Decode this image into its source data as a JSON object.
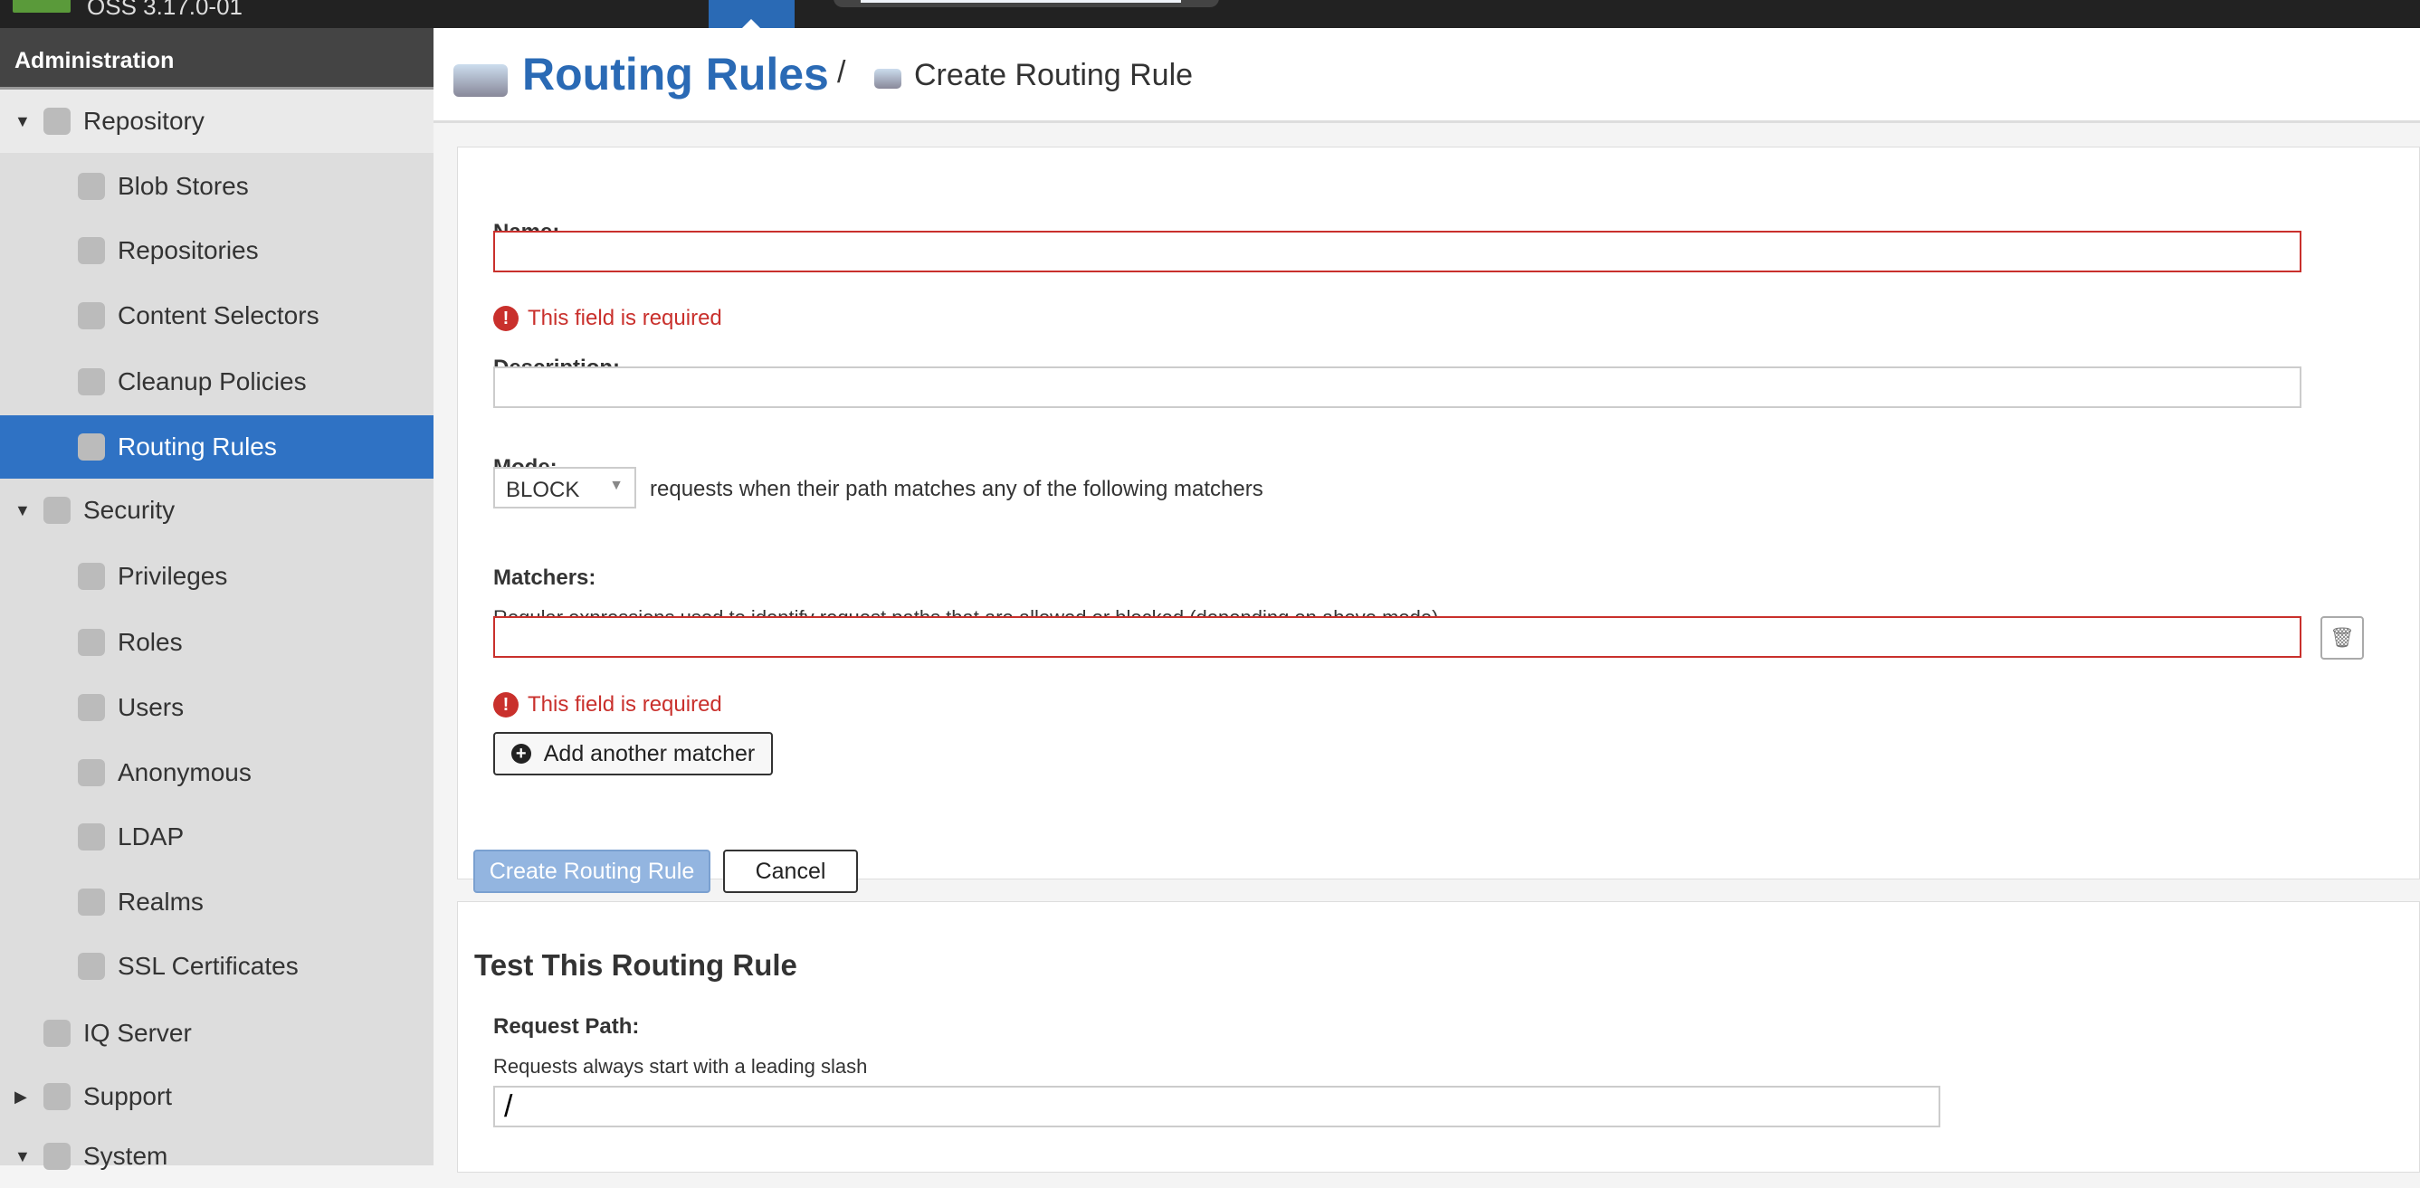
{
  "topbar": {
    "version": "OSS 3.17.0-01"
  },
  "sidebar": {
    "header": "Administration",
    "items": [
      {
        "label": "Repository",
        "icon": "database-icon",
        "expanded": true
      },
      {
        "label": "Blob Stores",
        "icon": "blob-store-icon"
      },
      {
        "label": "Repositories",
        "icon": "database-icon"
      },
      {
        "label": "Content Selectors",
        "icon": "content-selector-icon"
      },
      {
        "label": "Cleanup Policies",
        "icon": "broom-icon"
      },
      {
        "label": "Routing Rules",
        "icon": "router-icon",
        "selected": true
      },
      {
        "label": "Security",
        "icon": "security-icon",
        "expanded": true
      },
      {
        "label": "Privileges",
        "icon": "medal-icon"
      },
      {
        "label": "Roles",
        "icon": "role-icon"
      },
      {
        "label": "Users",
        "icon": "users-icon"
      },
      {
        "label": "Anonymous",
        "icon": "anonymous-icon"
      },
      {
        "label": "LDAP",
        "icon": "ldap-icon"
      },
      {
        "label": "Realms",
        "icon": "shield-icon"
      },
      {
        "label": "SSL Certificates",
        "icon": "certificate-icon"
      },
      {
        "label": "IQ Server",
        "icon": "iq-server-icon"
      },
      {
        "label": "Support",
        "icon": "lifebuoy-icon",
        "expanded": false
      },
      {
        "label": "System",
        "icon": "gear-icon",
        "expanded": true
      }
    ]
  },
  "header": {
    "title": "Routing Rules",
    "separator": "/",
    "subtitle": "Create Routing Rule"
  },
  "form": {
    "name_label": "Name:",
    "name_value": "",
    "name_error": "This field is required",
    "description_label": "Description:",
    "description_value": "",
    "mode_label": "Mode:",
    "mode_value": "BLOCK",
    "mode_suffix": "requests when their path matches any of the following matchers",
    "matchers_label": "Matchers:",
    "matchers_help": "Regular expressions used to identify request paths that are allowed or blocked (depending on above mode)",
    "matcher_value": "",
    "matcher_error": "This field is required",
    "add_matcher": "Add another matcher",
    "create": "Create Routing Rule",
    "cancel": "Cancel"
  },
  "test": {
    "title": "Test This Routing Rule",
    "path_label": "Request Path:",
    "path_help": "Requests always start with a leading slash",
    "path_value": "/"
  },
  "colors": {
    "accent": "#2a6ab5",
    "error": "#c9302c",
    "selected": "#2f72c4"
  }
}
